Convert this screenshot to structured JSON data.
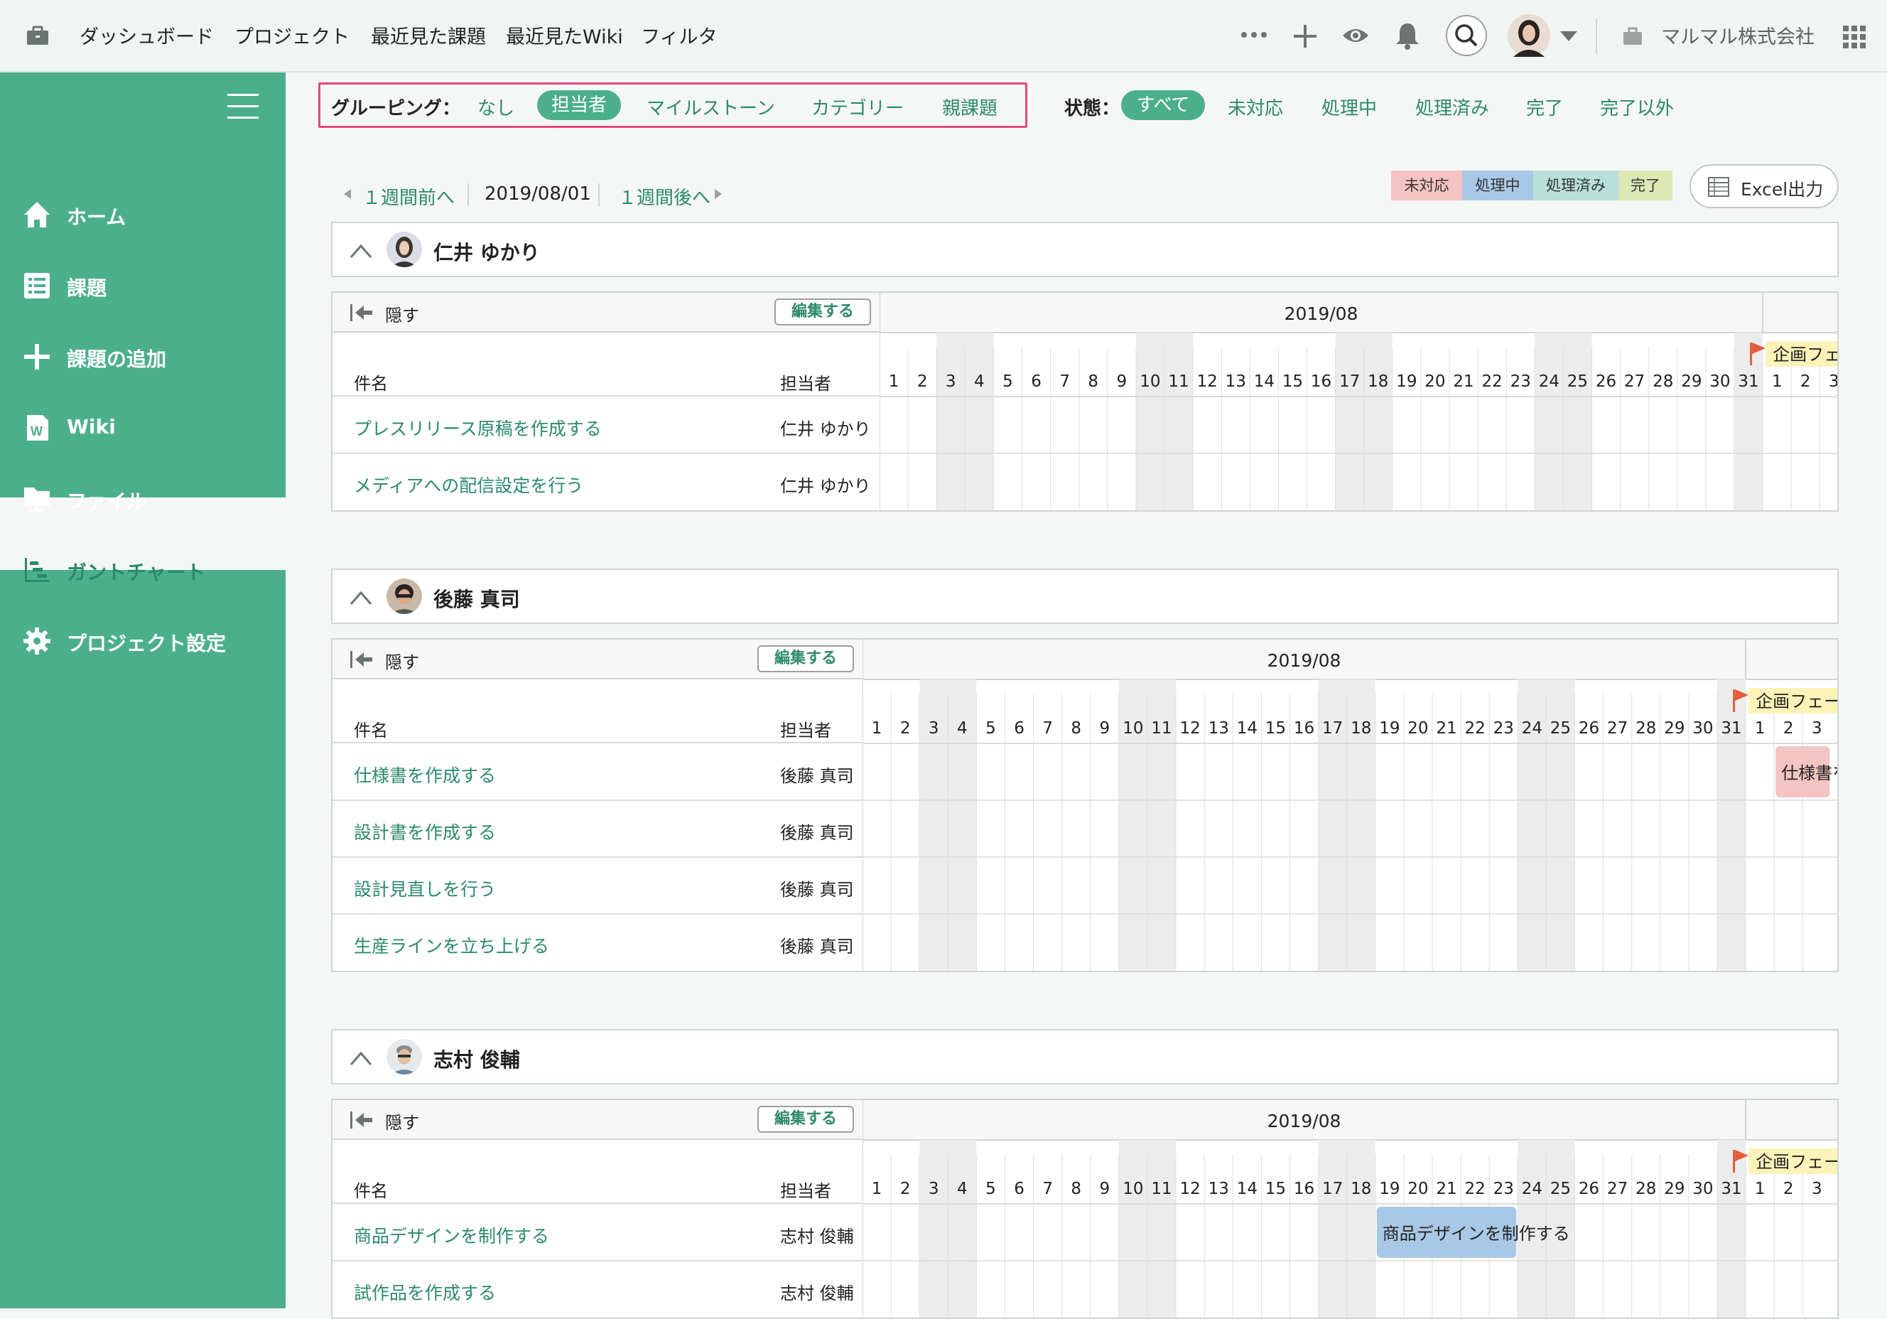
{
  "topnav": {
    "items": [
      "ダッシュボード",
      "プロジェクト",
      "最近見た課題",
      "最近見たWiki",
      "フィルタ"
    ],
    "company": "マルマル株式会社"
  },
  "sidebar": {
    "items": [
      {
        "label": "ホーム",
        "icon": "home-icon"
      },
      {
        "label": "課題",
        "icon": "list-icon"
      },
      {
        "label": "課題の追加",
        "icon": "plus-icon"
      },
      {
        "label": "Wiki",
        "icon": "wiki-icon"
      },
      {
        "label": "ファイル",
        "icon": "folder-icon"
      },
      {
        "label": "ガントチャート",
        "icon": "gantt-icon",
        "active": true
      },
      {
        "label": "プロジェクト設定",
        "icon": "gear-icon"
      }
    ]
  },
  "filters": {
    "grouping_label": "グルーピング：",
    "grouping_options": [
      "なし",
      "担当者",
      "マイルストーン",
      "カテゴリー",
      "親課題"
    ],
    "grouping_selected": "担当者",
    "status_label": "状態：",
    "status_options": [
      "すべて",
      "未対応",
      "処理中",
      "処理済み",
      "完了",
      "完了以外"
    ],
    "status_selected": "すべて"
  },
  "week_nav": {
    "prev": "１週間前へ",
    "date": "2019/08/01",
    "next": "１週間後へ"
  },
  "legend": [
    {
      "label": "未対応",
      "color": "#f4c4c2"
    },
    {
      "label": "処理中",
      "color": "#a9c8e6"
    },
    {
      "label": "処理済み",
      "color": "#b9e0d8"
    },
    {
      "label": "完了",
      "color": "#dde8b4"
    }
  ],
  "excel_label": "Excel出力",
  "table_labels": {
    "hide": "隠す",
    "edit": "編集する",
    "col_name": "件名",
    "col_assignee": "担当者",
    "month": "2019/08",
    "milestone": "企画フェーズ"
  },
  "days": [
    "1",
    "2",
    "3",
    "4",
    "5",
    "6",
    "7",
    "8",
    "9",
    "10",
    "11",
    "12",
    "13",
    "14",
    "15",
    "16",
    "17",
    "18",
    "19",
    "20",
    "21",
    "22",
    "23",
    "24",
    "25",
    "26",
    "27",
    "28",
    "29",
    "30",
    "31",
    "1",
    "2",
    "3"
  ],
  "groups": [
    {
      "name": "仁井 ゆかり",
      "tasks": [
        {
          "title": "プレスリリース原稿を作成する",
          "assignee": "仁井 ゆかり"
        },
        {
          "title": "メディアへの配信設定を行う",
          "assignee": "仁井 ゆかり"
        }
      ]
    },
    {
      "name": "後藤 真司",
      "tasks": [
        {
          "title": "仕様書を作成する",
          "assignee": "後藤 真司",
          "bar": {
            "label": "仕様書を作成する",
            "start_day": "2019-09-02",
            "status": "未対応"
          }
        },
        {
          "title": "設計書を作成する",
          "assignee": "後藤 真司"
        },
        {
          "title": "設計見直しを行う",
          "assignee": "後藤 真司"
        },
        {
          "title": "生産ラインを立ち上げる",
          "assignee": "後藤 真司"
        }
      ]
    },
    {
      "name": "志村 俊輔",
      "tasks": [
        {
          "title": "商品デザインを制作する",
          "assignee": "志村 俊輔",
          "bar": {
            "label": "商品デザインを制作する",
            "start_day": "2019-08-19",
            "end_day": "2019-08-23",
            "status": "処理中"
          }
        },
        {
          "title": "試作品を作成する",
          "assignee": "志村 俊輔"
        }
      ]
    }
  ]
}
